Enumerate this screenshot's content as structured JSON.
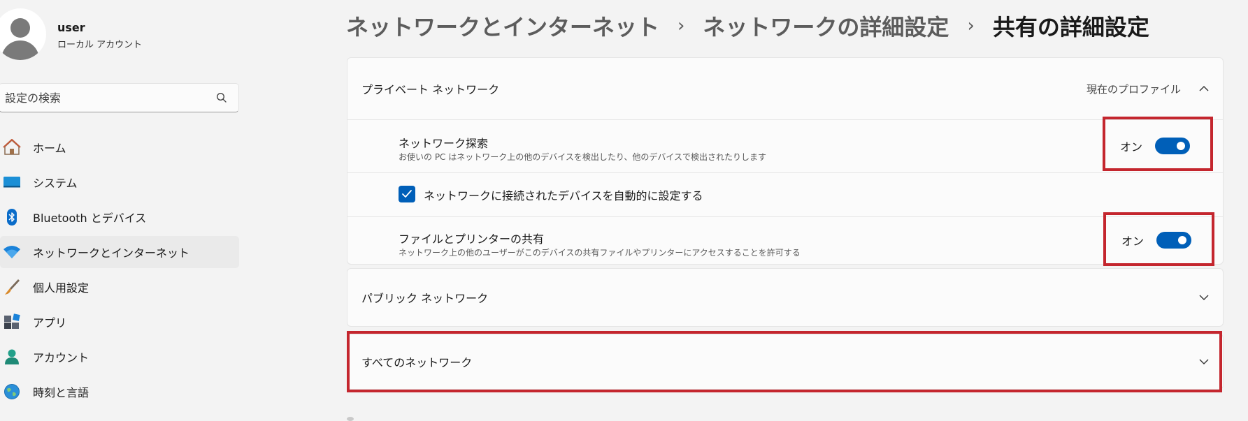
{
  "user": {
    "name": "user",
    "account_type": "ローカル アカウント"
  },
  "search": {
    "placeholder": "設定の検索"
  },
  "nav": [
    {
      "label": "ホーム",
      "icon": "home-icon",
      "active": false
    },
    {
      "label": "システム",
      "icon": "system-icon",
      "active": false
    },
    {
      "label": "Bluetooth とデバイス",
      "icon": "bluetooth-icon",
      "active": false
    },
    {
      "label": "ネットワークとインターネット",
      "icon": "wifi-icon",
      "active": true
    },
    {
      "label": "個人用設定",
      "icon": "brush-icon",
      "active": false
    },
    {
      "label": "アプリ",
      "icon": "apps-icon",
      "active": false
    },
    {
      "label": "アカウント",
      "icon": "account-icon",
      "active": false
    },
    {
      "label": "時刻と言語",
      "icon": "globe-icon",
      "active": false
    }
  ],
  "breadcrumb": {
    "level1": "ネットワークとインターネット",
    "separator": "›",
    "level2": "ネットワークの詳細設定",
    "current": "共有の詳細設定"
  },
  "private_network": {
    "title": "プライベート ネットワーク",
    "profile_status": "現在のプロファイル",
    "network_discovery": {
      "title": "ネットワーク探索",
      "description": "お使いの PC はネットワーク上の他のデバイスを検出したり、他のデバイスで検出されたりします",
      "state_label": "オン",
      "on": true
    },
    "auto_setup": {
      "label": "ネットワークに接続されたデバイスを自動的に設定する",
      "checked": true
    },
    "file_printer_sharing": {
      "title": "ファイルとプリンターの共有",
      "description": "ネットワーク上の他のユーザーがこのデバイスの共有ファイルやプリンターにアクセスすることを許可する",
      "state_label": "オン",
      "on": true
    }
  },
  "public_network": {
    "title": "パブリック ネットワーク"
  },
  "all_networks": {
    "title": "すべてのネットワーク"
  },
  "colors": {
    "accent": "#005fb8",
    "highlight": "#c4262e",
    "background": "#f3f3f3",
    "card": "#fbfbfb"
  }
}
